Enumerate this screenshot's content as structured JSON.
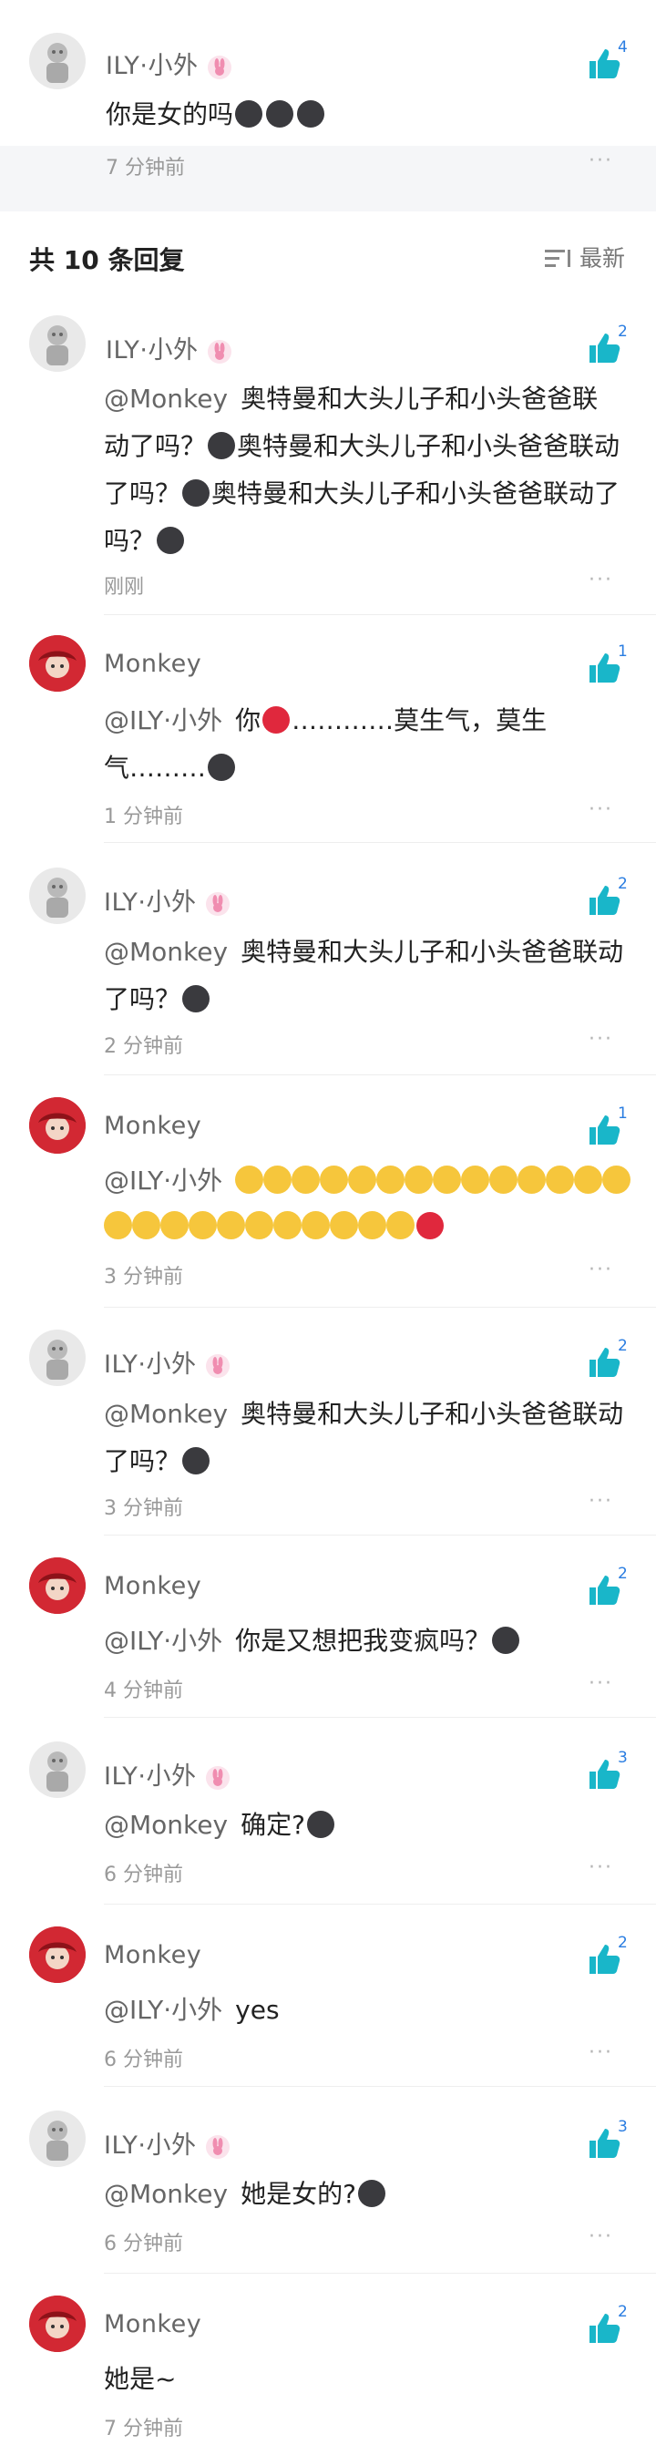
{
  "top_comment": {
    "user": "ILY·小外",
    "text": "你是女的吗",
    "likes": "4",
    "time": "7 分钟前",
    "more": "···"
  },
  "section": {
    "title": "共 10 条回复",
    "sort_label": "最新"
  },
  "replies": [
    {
      "user": "ILY·小外",
      "mention": "@Monkey",
      "text": "奥特曼和大头儿子和小头爸爸联动了吗？",
      "likes": "2",
      "time": "刚刚"
    },
    {
      "user": "Monkey",
      "mention": "@ILY·小外",
      "text": "你",
      "text2": "…………莫生气，莫生气………",
      "likes": "1",
      "time": "1 分钟前"
    },
    {
      "user": "ILY·小外",
      "mention": "@Monkey",
      "text": "奥特曼和大头儿子和小头爸爸联动了吗？",
      "likes": "2",
      "time": "2 分钟前"
    },
    {
      "user": "Monkey",
      "mention": "@ILY·小外",
      "text": "",
      "likes": "1",
      "time": "3 分钟前"
    },
    {
      "user": "ILY·小外",
      "mention": "@Monkey",
      "text": "奥特曼和大头儿子和小头爸爸联动了吗？",
      "likes": "2",
      "time": "3 分钟前"
    },
    {
      "user": "Monkey",
      "mention": "@ILY·小外",
      "text": "你是又想把我变疯吗？",
      "likes": "2",
      "time": "4 分钟前"
    },
    {
      "user": "ILY·小外",
      "mention": "@Monkey",
      "text": "确定?",
      "likes": "3",
      "time": "6 分钟前"
    },
    {
      "user": "Monkey",
      "mention": "@ILY·小外",
      "text": "yes",
      "likes": "2",
      "time": "6 分钟前"
    },
    {
      "user": "ILY·小外",
      "mention": "@Monkey",
      "text": "她是女的?",
      "likes": "3",
      "time": "6 分钟前"
    },
    {
      "user": "Monkey",
      "mention": "",
      "text": "她是~",
      "likes": "2",
      "time": "7 分钟前"
    }
  ],
  "more_label": "···",
  "colors": {
    "accent": "#2a7de1",
    "like_teal": "#19b6c9",
    "muted": "#999999"
  }
}
